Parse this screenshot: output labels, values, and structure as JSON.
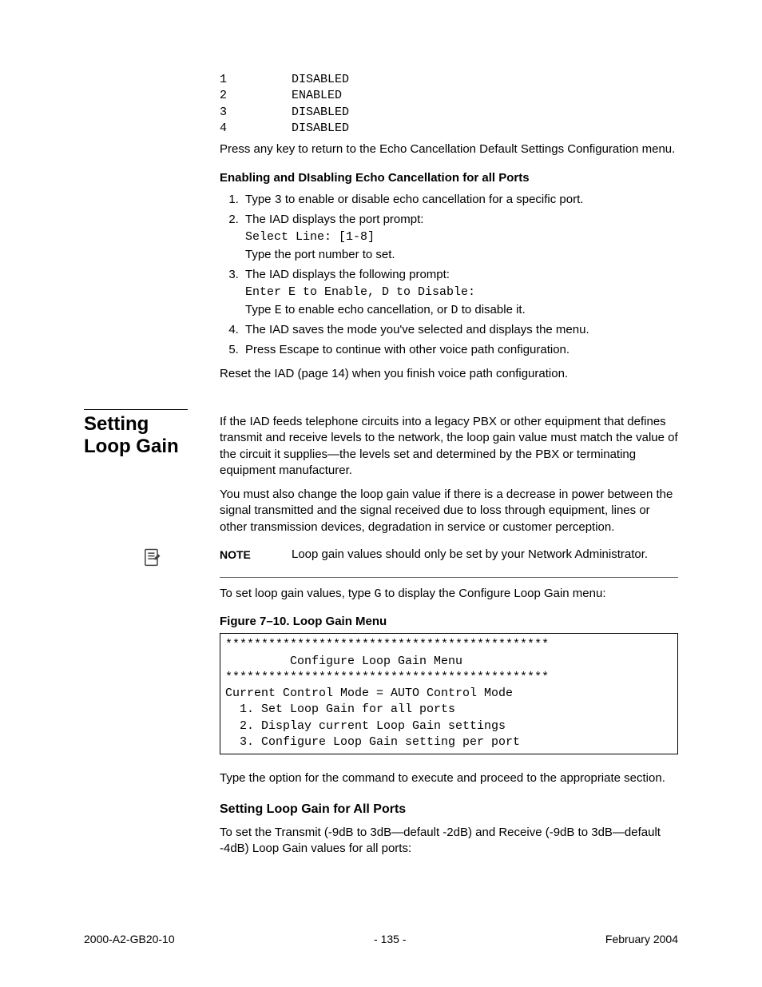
{
  "port_table": {
    "rows": [
      {
        "num": "1",
        "state": "DISABLED"
      },
      {
        "num": "2",
        "state": "ENABLED"
      },
      {
        "num": "3",
        "state": "DISABLED"
      },
      {
        "num": "4",
        "state": "DISABLED"
      }
    ]
  },
  "press_any_key": "Press any key to return to the Echo Cancellation Default Settings Configuration menu.",
  "echo_subhead": "Enabling and DIsabling Echo Cancellation for all Ports",
  "steps": {
    "s1_pre": "Type ",
    "s1_code": "3",
    "s1_post": " to enable or disable echo cancellation for a specific port.",
    "s2_a": "The IAD displays the port prompt:",
    "s2_code": "Select Line: [1-8]",
    "s2_b": "Type the port number to set.",
    "s3_a": "The IAD displays the following prompt:",
    "s3_code": "Enter E to Enable, D to Disable:",
    "s3_b_pre": "Type ",
    "s3_b_code1": "E",
    "s3_b_mid": " to enable echo cancellation, or ",
    "s3_b_code2": "D",
    "s3_b_post": " to disable it.",
    "s4": "The IAD saves the mode you've selected and displays the menu.",
    "s5": "Press Escape to continue with other voice path configuration."
  },
  "reset_text": "Reset the IAD (page 14) when you finish voice path configuration.",
  "section": {
    "title": "Setting Loop Gain",
    "p1": "If the IAD feeds telephone circuits into a legacy PBX or other equipment that defines transmit and receive levels to the network, the loop gain value must match the value of the circuit it supplies—the levels set and determined by the PBX or terminating equipment manufacturer.",
    "p2": "You must also change the loop gain value if there is a decrease in power between the signal transmitted and the signal received due to loss through equipment, lines or other transmission devices, degradation in service or customer perception."
  },
  "note": {
    "label": "NOTE",
    "text": "Loop gain values should only be set by your Network Administrator."
  },
  "to_set_pre": "To set loop gain values, type ",
  "to_set_code": "G",
  "to_set_post": " to display the Configure Loop Gain menu:",
  "figure_caption": "Figure 7–10.  Loop Gain Menu",
  "menu_box": "*********************************************\n         Configure Loop Gain Menu\n*********************************************\nCurrent Control Mode = AUTO Control Mode\n  1. Set Loop Gain for all ports\n  2. Display current Loop Gain settings\n  3. Configure Loop Gain setting per port",
  "type_option": "Type the option for the command to execute and proceed to the appropriate section.",
  "subhead2": "Setting Loop Gain for All Ports",
  "set_transmit": "To set the Transmit (-9dB to 3dB—default -2dB) and Receive (-9dB to 3dB—default -4dB) Loop Gain values for all ports:",
  "footer": {
    "left": "2000-A2-GB20-10",
    "center": "- 135 -",
    "right": "February 2004"
  }
}
